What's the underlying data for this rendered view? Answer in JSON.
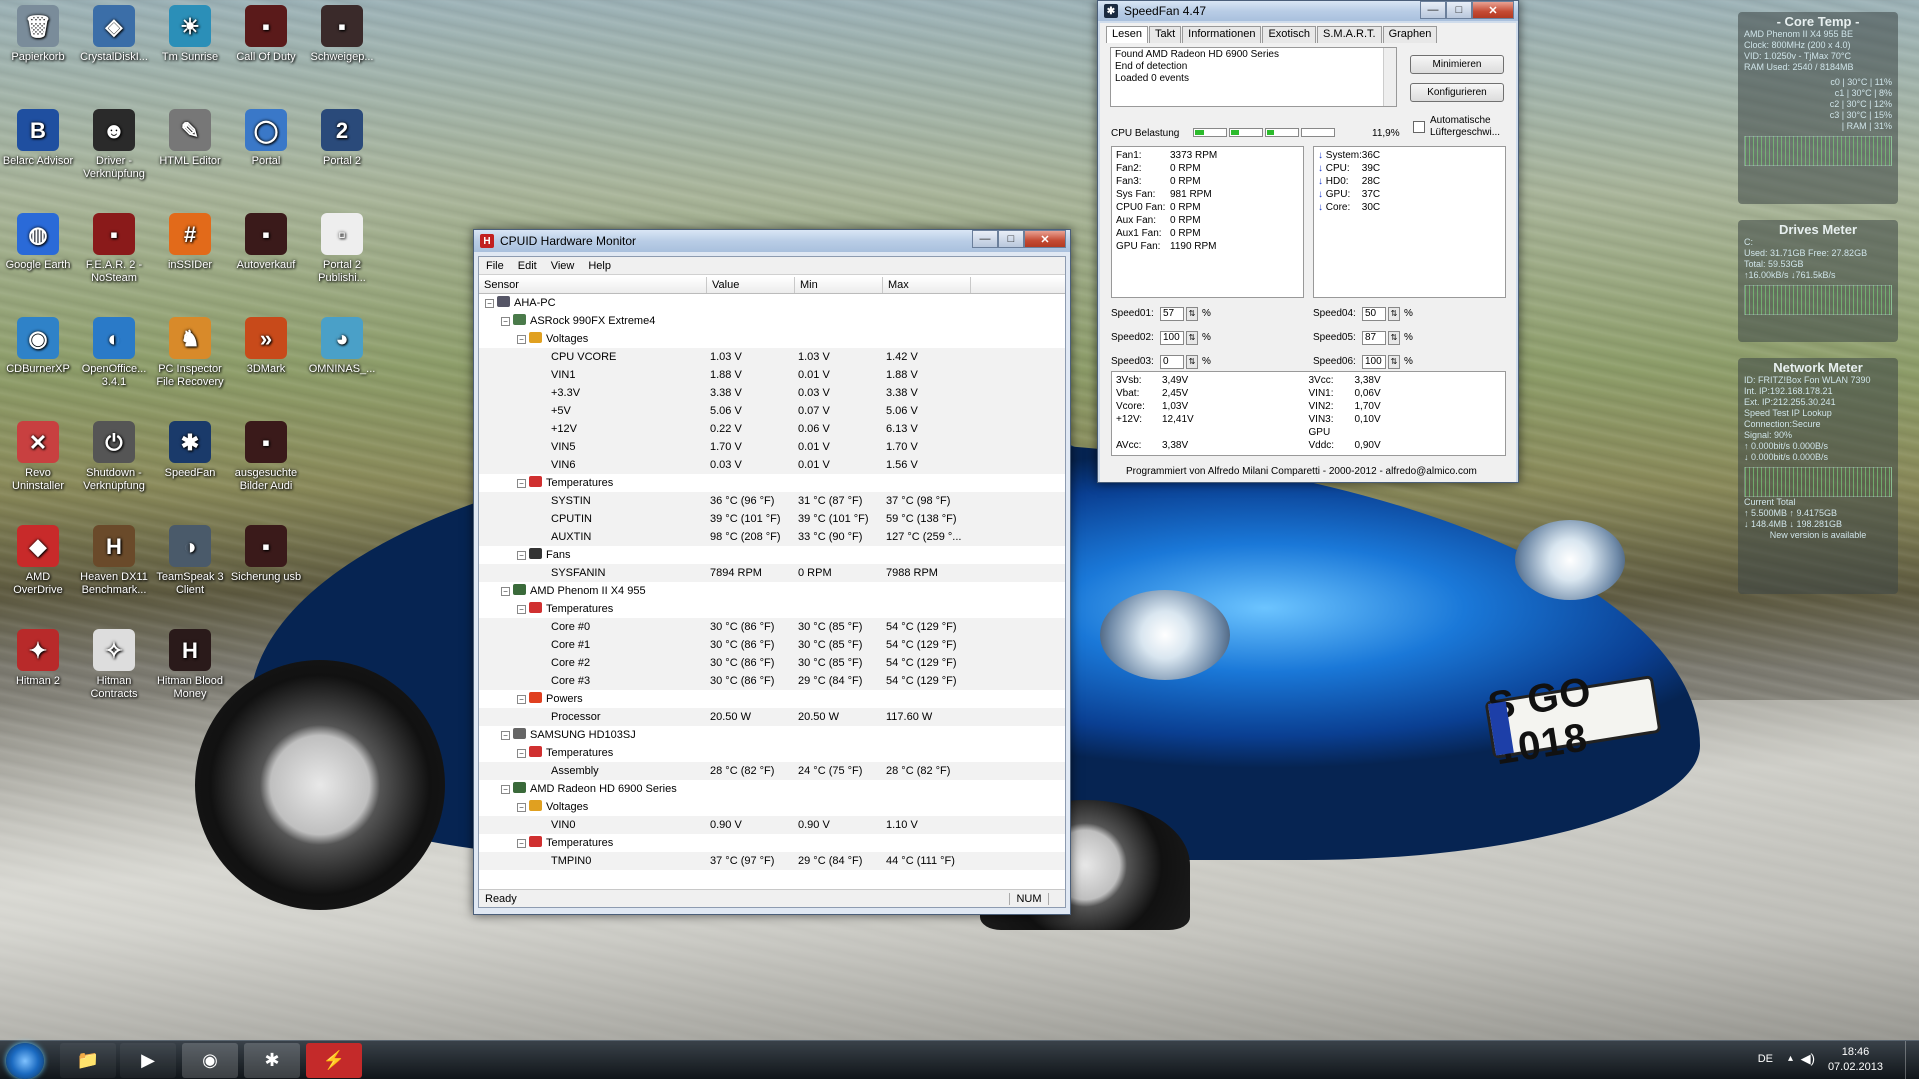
{
  "desktop": {
    "icons": [
      {
        "label": "Papierkorb"
      },
      {
        "label": "CrystalDiskI..."
      },
      {
        "label": "Tm Sunrise"
      },
      {
        "label": "Call Of Duty"
      },
      {
        "label": "Schweigep..."
      },
      {
        "label": "Belarc Advisor"
      },
      {
        "label": "Driver - Verknüpfung"
      },
      {
        "label": "HTML Editor"
      },
      {
        "label": "Portal"
      },
      {
        "label": "Portal 2"
      },
      {
        "label": "Google Earth"
      },
      {
        "label": "F.E.A.R. 2 - NoSteam"
      },
      {
        "label": "inSSIDer"
      },
      {
        "label": "Autoverkauf"
      },
      {
        "label": "Portal 2 Publishi..."
      },
      {
        "label": "CDBurnerXP"
      },
      {
        "label": "OpenOffice... 3.4.1"
      },
      {
        "label": "PC Inspector File Recovery"
      },
      {
        "label": "3DMark"
      },
      {
        "label": "OMNINAS_..."
      },
      {
        "label": "Revo Uninstaller"
      },
      {
        "label": "Shutdown - Verknüpfung"
      },
      {
        "label": "SpeedFan"
      },
      {
        "label": "ausgesuchte Bilder Audi"
      },
      {
        "label": "AMD OverDrive"
      },
      {
        "label": "Heaven DX11 Benchmark..."
      },
      {
        "label": "TeamSpeak 3 Client"
      },
      {
        "label": "Sicherung usb"
      },
      {
        "label": "Hitman 2"
      },
      {
        "label": "Hitman Contracts"
      },
      {
        "label": "Hitman Blood Money"
      }
    ],
    "plate": "S GO 1018"
  },
  "hwmonitor": {
    "title": "CPUID Hardware Monitor",
    "menu": [
      "File",
      "Edit",
      "View",
      "Help"
    ],
    "columns": [
      "Sensor",
      "Value",
      "Min",
      "Max"
    ],
    "rows": [
      {
        "indent": 0,
        "exp": "-",
        "label": "AHA-PC",
        "v": "",
        "mn": "",
        "mx": "",
        "icon": "pc"
      },
      {
        "indent": 1,
        "exp": "-",
        "label": "ASRock 990FX Extreme4",
        "v": "",
        "mn": "",
        "mx": "",
        "icon": "board"
      },
      {
        "indent": 2,
        "exp": "-",
        "label": "Voltages",
        "v": "",
        "mn": "",
        "mx": "",
        "icon": "volt"
      },
      {
        "indent": 3,
        "label": "CPU VCORE",
        "v": "1.03 V",
        "mn": "1.03 V",
        "mx": "1.42 V"
      },
      {
        "indent": 3,
        "label": "VIN1",
        "v": "1.88 V",
        "mn": "0.01 V",
        "mx": "1.88 V"
      },
      {
        "indent": 3,
        "label": "+3.3V",
        "v": "3.38 V",
        "mn": "0.03 V",
        "mx": "3.38 V"
      },
      {
        "indent": 3,
        "label": "+5V",
        "v": "5.06 V",
        "mn": "0.07 V",
        "mx": "5.06 V"
      },
      {
        "indent": 3,
        "label": "+12V",
        "v": "0.22 V",
        "mn": "0.06 V",
        "mx": "6.13 V"
      },
      {
        "indent": 3,
        "label": "VIN5",
        "v": "1.70 V",
        "mn": "0.01 V",
        "mx": "1.70 V"
      },
      {
        "indent": 3,
        "label": "VIN6",
        "v": "0.03 V",
        "mn": "0.01 V",
        "mx": "1.56 V"
      },
      {
        "indent": 2,
        "exp": "-",
        "label": "Temperatures",
        "v": "",
        "mn": "",
        "mx": "",
        "icon": "temp"
      },
      {
        "indent": 3,
        "label": "SYSTIN",
        "v": "36 °C (96 °F)",
        "mn": "31 °C (87 °F)",
        "mx": "37 °C (98 °F)"
      },
      {
        "indent": 3,
        "label": "CPUTIN",
        "v": "39 °C (101 °F)",
        "mn": "39 °C (101 °F)",
        "mx": "59 °C (138 °F)"
      },
      {
        "indent": 3,
        "label": "AUXTIN",
        "v": "98 °C (208 °F)",
        "mn": "33 °C (90 °F)",
        "mx": "127 °C (259 °..."
      },
      {
        "indent": 2,
        "exp": "-",
        "label": "Fans",
        "v": "",
        "mn": "",
        "mx": "",
        "icon": "fan"
      },
      {
        "indent": 3,
        "label": "SYSFANIN",
        "v": "7894 RPM",
        "mn": "0 RPM",
        "mx": "7988 RPM"
      },
      {
        "indent": 1,
        "exp": "-",
        "label": "AMD Phenom II X4 955",
        "v": "",
        "mn": "",
        "mx": "",
        "icon": "cpu"
      },
      {
        "indent": 2,
        "exp": "-",
        "label": "Temperatures",
        "v": "",
        "mn": "",
        "mx": "",
        "icon": "temp"
      },
      {
        "indent": 3,
        "label": "Core #0",
        "v": "30 °C (86 °F)",
        "mn": "30 °C (85 °F)",
        "mx": "54 °C (129 °F)"
      },
      {
        "indent": 3,
        "label": "Core #1",
        "v": "30 °C (86 °F)",
        "mn": "30 °C (85 °F)",
        "mx": "54 °C (129 °F)"
      },
      {
        "indent": 3,
        "label": "Core #2",
        "v": "30 °C (86 °F)",
        "mn": "30 °C (85 °F)",
        "mx": "54 °C (129 °F)"
      },
      {
        "indent": 3,
        "label": "Core #3",
        "v": "30 °C (86 °F)",
        "mn": "29 °C (84 °F)",
        "mx": "54 °C (129 °F)"
      },
      {
        "indent": 2,
        "exp": "-",
        "label": "Powers",
        "v": "",
        "mn": "",
        "mx": "",
        "icon": "power"
      },
      {
        "indent": 3,
        "label": "Processor",
        "v": "20.50 W",
        "mn": "20.50 W",
        "mx": "117.60 W"
      },
      {
        "indent": 1,
        "exp": "-",
        "label": "SAMSUNG HD103SJ",
        "v": "",
        "mn": "",
        "mx": "",
        "icon": "hdd"
      },
      {
        "indent": 2,
        "exp": "-",
        "label": "Temperatures",
        "v": "",
        "mn": "",
        "mx": "",
        "icon": "temp"
      },
      {
        "indent": 3,
        "label": "Assembly",
        "v": "28 °C (82 °F)",
        "mn": "24 °C (75 °F)",
        "mx": "28 °C (82 °F)"
      },
      {
        "indent": 1,
        "exp": "-",
        "label": "AMD Radeon HD 6900 Series",
        "v": "",
        "mn": "",
        "mx": "",
        "icon": "gpu"
      },
      {
        "indent": 2,
        "exp": "-",
        "label": "Voltages",
        "v": "",
        "mn": "",
        "mx": "",
        "icon": "volt"
      },
      {
        "indent": 3,
        "label": "VIN0",
        "v": "0.90 V",
        "mn": "0.90 V",
        "mx": "1.10 V"
      },
      {
        "indent": 2,
        "exp": "-",
        "label": "Temperatures",
        "v": "",
        "mn": "",
        "mx": "",
        "icon": "temp"
      },
      {
        "indent": 3,
        "label": "TMPIN0",
        "v": "37 °C (97 °F)",
        "mn": "29 °C (84 °F)",
        "mx": "44 °C (111 °F)"
      }
    ],
    "status": "Ready",
    "num": "NUM"
  },
  "speedfan": {
    "title": "SpeedFan 4.47",
    "tabs": [
      "Lesen",
      "Takt",
      "Informationen",
      "Exotisch",
      "S.M.A.R.T.",
      "Graphen"
    ],
    "log": [
      "Found AMD Radeon HD 6900 Series",
      "End of detection",
      "Loaded 0 events"
    ],
    "btn_min": "Minimieren",
    "btn_conf": "Konfigurieren",
    "cpu_label": "CPU Belastung",
    "cpu_pct": "11,9%",
    "cpu_loads": [
      0.12,
      0.1,
      0.09,
      0.0
    ],
    "auto_label": "Automatische Lüftergeschwi...",
    "fans": [
      "Fan1:",
      "3373 RPM",
      "Fan2:",
      "0 RPM",
      "Fan3:",
      "0 RPM",
      "Sys Fan:",
      "981 RPM",
      "CPU0 Fan:",
      "0 RPM",
      "Aux Fan:",
      "0 RPM",
      "Aux1 Fan:",
      "0 RPM",
      "GPU Fan:",
      "1190 RPM"
    ],
    "temps": [
      "System:",
      "36C",
      "CPU:",
      "39C",
      "HD0:",
      "28C",
      "GPU:",
      "37C",
      "Core:",
      "30C"
    ],
    "speeds": [
      {
        "label": "Speed01:",
        "val": "57"
      },
      {
        "label": "Speed04:",
        "val": "50"
      },
      {
        "label": "Speed02:",
        "val": "100"
      },
      {
        "label": "Speed05:",
        "val": "87"
      },
      {
        "label": "Speed03:",
        "val": "0"
      },
      {
        "label": "Speed06:",
        "val": "100"
      }
    ],
    "volts": [
      "3Vsb:",
      "3,49V",
      "3Vcc:",
      "3,38V",
      "Vbat:",
      "2,45V",
      "VIN1:",
      "0,06V",
      "Vcore:",
      "1,03V",
      "VIN2:",
      "1,70V",
      "+12V:",
      "12,41V",
      "VIN3:",
      "0,10V",
      "AVcc:",
      "3,38V",
      "GPU Vddc:",
      "0,90V"
    ],
    "footer": "Programmiert von Alfredo Milani Comparetti - 2000-2012 - alfredo@almico.com"
  },
  "gadgets": {
    "coretemp": {
      "title": "- Core Temp -",
      "lines": [
        "AMD Phenom II X4 955 BE",
        "Clock: 800MHz (200 x 4.0)",
        "VID: 1.0250v - TjMax 70°C",
        "RAM Used: 2540 / 8184MB"
      ],
      "rows": [
        "c0 | 30°C | 11%",
        "c1 | 30°C | 8%",
        "c2 | 30°C | 12%",
        "c3 | 30°C | 15%",
        "| RAM | 31%"
      ]
    },
    "drives": {
      "title": "Drives Meter",
      "lines": [
        "C:",
        "Used: 31.71GB   Free: 27.82GB",
        "Total: 59.53GB",
        "↑16.00kB/s   ↓761.5kB/s"
      ]
    },
    "network": {
      "title": "Network Meter",
      "lines": [
        "ID: FRITZ!Box Fon WLAN 7390",
        "Int. IP:192.168.178.21",
        "Ext. IP:212.255.30.241",
        "Speed Test      IP Lookup",
        "Connection:Secure",
        "Signal: 90%",
        "↑ 0.000bit/s    0.000B/s",
        "↓ 0.000bit/s    0.000B/s",
        "Current        Total",
        "↑ 5.500MB    ↑ 9.4175GB",
        "↓ 148.4MB    ↓ 198.281GB",
        "New version is available"
      ]
    }
  },
  "taskbar": {
    "lang": "DE",
    "time": "18:46",
    "date": "07.02.2013"
  }
}
